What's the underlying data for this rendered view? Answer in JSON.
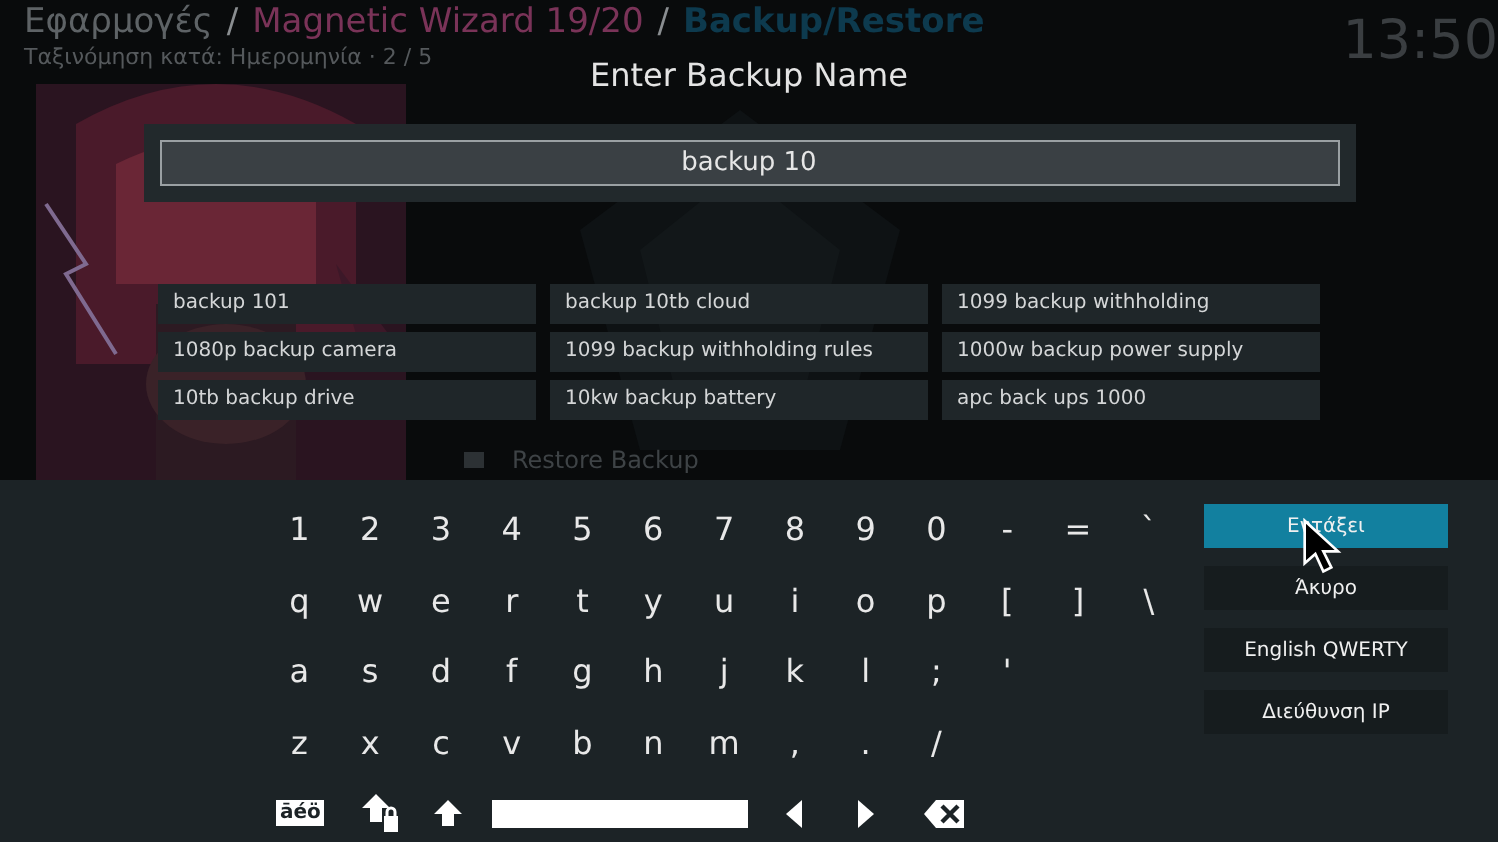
{
  "header": {
    "breadcrumb": [
      {
        "text": "Εφαρμογές",
        "kind": "root"
      },
      {
        "separator": "/",
        "text": "Magnetic Wizard 19/20",
        "kind": "addon"
      },
      {
        "separator": "/",
        "text": "Backup/Restore",
        "kind": "current"
      }
    ],
    "sort": "Ταξινόμηση κατά: Ημερομηνία · 2 / 5",
    "time": "13:50"
  },
  "background_list": [
    {
      "label": "Restore Backup"
    }
  ],
  "dialog": {
    "title": "Enter Backup Name",
    "value": "backup 10",
    "suggestions": [
      "backup 101",
      "backup 10tb cloud",
      "1099 backup withholding",
      "1080p backup camera",
      "1099 backup withholding rules",
      "1000w backup power supply",
      "10tb backup drive",
      "10kw backup battery",
      "apc back ups 1000"
    ]
  },
  "keyboard": {
    "rows": [
      [
        "1",
        "2",
        "3",
        "4",
        "5",
        "6",
        "7",
        "8",
        "9",
        "0",
        "-",
        "=",
        "`"
      ],
      [
        "q",
        "w",
        "e",
        "r",
        "t",
        "y",
        "u",
        "i",
        "o",
        "p",
        "[",
        "]",
        "\\"
      ],
      [
        "a",
        "s",
        "d",
        "f",
        "g",
        "h",
        "j",
        "k",
        "l",
        ";",
        "'"
      ],
      [
        "z",
        "x",
        "c",
        "v",
        "b",
        "n",
        "m",
        ",",
        ".",
        "/"
      ]
    ],
    "special": [
      {
        "kind": "accents",
        "label": "āéö"
      },
      {
        "kind": "capslock"
      },
      {
        "kind": "shift"
      },
      {
        "kind": "space"
      },
      {
        "kind": "left"
      },
      {
        "kind": "right"
      },
      {
        "kind": "backspace"
      }
    ]
  },
  "buttons": [
    {
      "label": "Εντάξει",
      "selected": true
    },
    {
      "label": "Άκυρο",
      "selected": false
    },
    {
      "label": "English QWERTY",
      "selected": false
    },
    {
      "label": "Διεύθυνση IP",
      "selected": false
    }
  ]
}
